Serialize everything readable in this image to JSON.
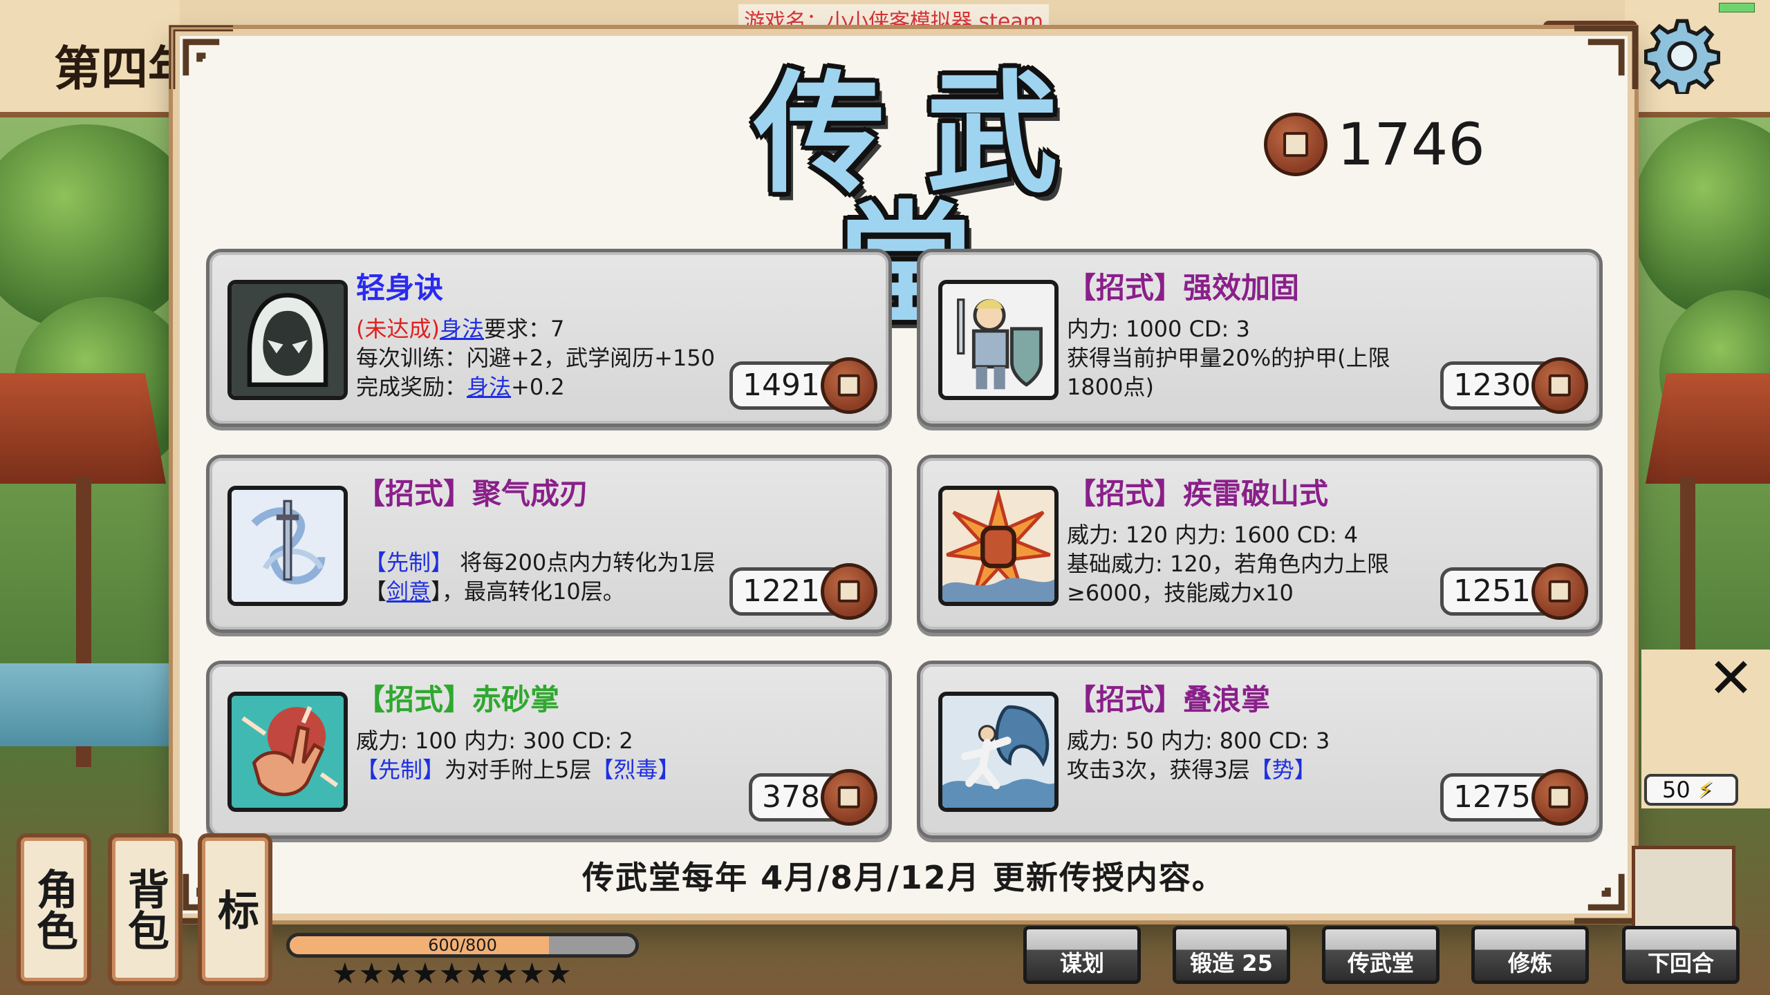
{
  "window": {
    "game_name_label": "游戏名：小小侠客模拟器 steam",
    "year_label": "第四年"
  },
  "dialog": {
    "title": "传武堂",
    "coin_total": "1746",
    "footer_note": "传武堂每年 4月/8月/12月 更新传授内容。"
  },
  "cards": [
    {
      "name": "轻身诀",
      "name_color": "#2a2af0",
      "icon": "hooded-ninja-icon",
      "req_prefix": "(未达成)",
      "req_link": "身法",
      "req_suffix": "要求：7",
      "line2": "每次训练：闪避+2，武学阅历+150",
      "reward_prefix": "完成奖励：",
      "reward_link": "身法",
      "reward_suffix": "+0.2",
      "price": "1491"
    },
    {
      "name": "【招式】强效加固",
      "name_color": "#8a1f8a",
      "icon": "armored-knight-icon",
      "line1": "内力: 1000  CD: 3",
      "line2": "获得当前护甲量20%的护甲(上限",
      "line3": "1800点)",
      "price": "1230"
    },
    {
      "name": "【招式】聚气成刃",
      "name_color": "#8a1f8a",
      "icon": "wind-sword-icon",
      "l1_link": "【先制】",
      "l1_text": " 将每200点内力转化为1层",
      "l2_open": "【",
      "l2_link": "剑意",
      "l2_text": "】，最高转化10层。",
      "price": "1221"
    },
    {
      "name": "【招式】疾雷破山式",
      "name_color": "#8a1f8a",
      "icon": "thunder-fist-icon",
      "line1": "威力: 120  内力: 1600  CD: 4",
      "line2": "基础威力: 120，若角色内力上限",
      "line3": "≥6000，技能威力x10",
      "price": "1251"
    },
    {
      "name": "【招式】赤砂掌",
      "name_color": "#2fa82f",
      "icon": "red-palm-icon",
      "line1": "威力: 100  内力: 300  CD: 2",
      "l2_link": "【先制】",
      "l2_text": "为对手附上5层",
      "l2_link2": "【烈毒】",
      "price": "378"
    },
    {
      "name": "【招式】叠浪掌",
      "name_color": "#8a1f8a",
      "icon": "wave-fighter-icon",
      "line1": "威力: 50  内力: 800  CD: 3",
      "l2_text": "攻击3次，获得3层",
      "l2_link": "【势】",
      "price": "1275"
    }
  ],
  "hud": {
    "side_buttons": [
      "角色",
      "背包",
      "标"
    ],
    "hp_text": "600/800",
    "hp_fraction": 0.75,
    "stars": "★★★★★★★★★",
    "energy": "50",
    "actions": [
      {
        "label": "谋划"
      },
      {
        "label": "锻造  25"
      },
      {
        "label": "传武堂"
      },
      {
        "label": "修炼"
      },
      {
        "label": "下回合"
      }
    ]
  },
  "colors": {
    "title_fill": "#9ed4f0",
    "link_blue": "#1f2fe0",
    "warn_red": "#e02020",
    "close_red": "#c64a43"
  }
}
